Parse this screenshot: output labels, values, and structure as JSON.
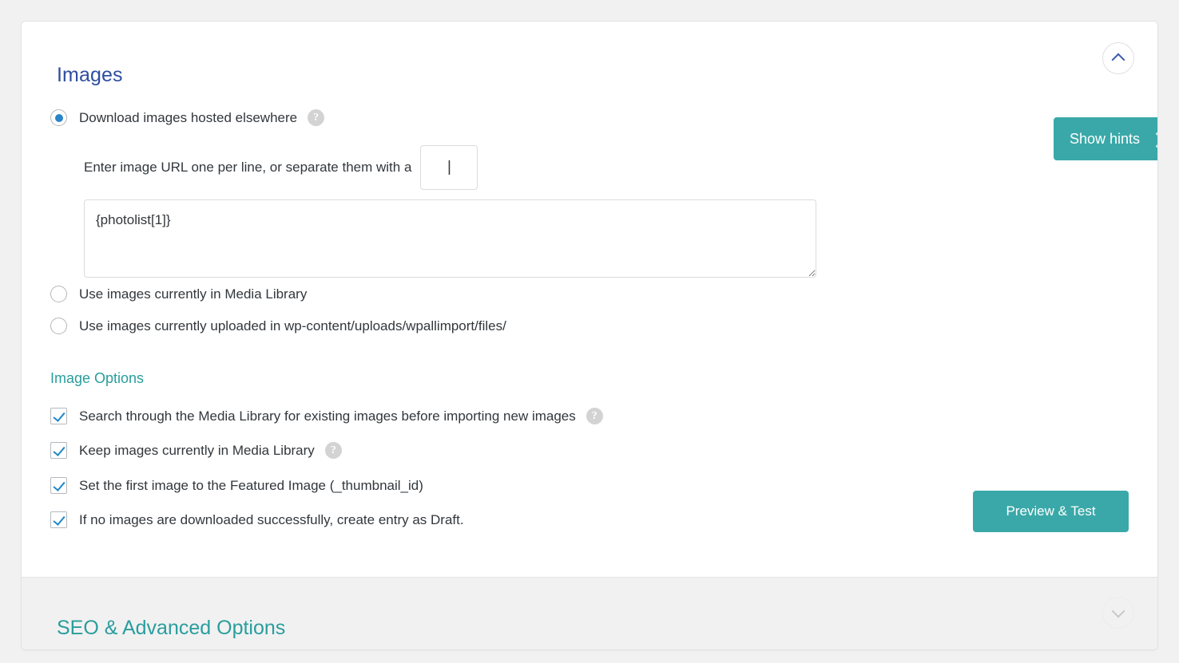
{
  "panel": {
    "section_title": "Images",
    "collapse_icon": "chevron-up-icon"
  },
  "hints": {
    "label": "Show hints",
    "icon": "chevron-right-icon"
  },
  "image_source": {
    "options": [
      {
        "label": "Download images hosted elsewhere",
        "selected": true,
        "help_icon": "question-mark-icon",
        "help_glyph": "?"
      },
      {
        "label": "Use images currently in Media Library",
        "selected": false
      },
      {
        "label": "Use images currently uploaded in wp-content/uploads/wpallimport/files/",
        "selected": false
      }
    ]
  },
  "separator": {
    "text": "Enter image URL one per line, or separate them with a",
    "value": "|",
    "placeholder": ""
  },
  "url_textarea": {
    "value": "{photolist[1]}",
    "placeholder": ""
  },
  "image_options": {
    "title": "Image Options",
    "checkboxes": [
      {
        "label": "Search through the Media Library for existing images before importing new images",
        "checked": true,
        "help_glyph": "?"
      },
      {
        "label": "Keep images currently in Media Library",
        "checked": true,
        "help_glyph": "?"
      },
      {
        "label": "Set the first image to the Featured Image (_thumbnail_id)",
        "checked": true
      },
      {
        "label": "If no images are downloaded successfully, create entry as Draft.",
        "checked": true
      }
    ]
  },
  "actions": {
    "preview_test": "Preview & Test"
  },
  "seo_section": {
    "title": "SEO & Advanced Options",
    "expand_icon": "chevron-down-icon"
  },
  "colors": {
    "teal": "#3aa8a8",
    "heading_blue": "#2e4e9e",
    "accent_blue": "#2b84c8",
    "page_bg": "#f1f1f1"
  }
}
